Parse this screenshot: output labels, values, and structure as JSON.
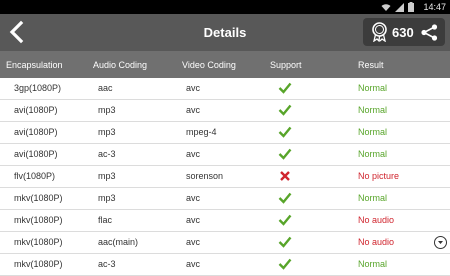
{
  "status": {
    "time": "14:47",
    "icons": [
      "wifi-icon",
      "signal-icon",
      "battery-icon"
    ]
  },
  "header": {
    "title": "Details",
    "score": "630"
  },
  "table": {
    "columns": [
      "Encapsulation",
      "Audio Coding",
      "Video Coding",
      "Support",
      "Result"
    ],
    "rows": [
      {
        "enc": "3gp(1080P)",
        "audio": "aac",
        "video": "avc",
        "support": "check",
        "result": "Normal",
        "status": "normal"
      },
      {
        "enc": "avi(1080P)",
        "audio": "mp3",
        "video": "avc",
        "support": "check",
        "result": "Normal",
        "status": "normal"
      },
      {
        "enc": "avi(1080P)",
        "audio": "mp3",
        "video": "mpeg-4",
        "support": "check",
        "result": "Normal",
        "status": "normal"
      },
      {
        "enc": "avi(1080P)",
        "audio": "ac-3",
        "video": "avc",
        "support": "check",
        "result": "Normal",
        "status": "normal"
      },
      {
        "enc": "flv(1080P)",
        "audio": "mp3",
        "video": "sorenson",
        "support": "cross",
        "result": "No picture",
        "status": "bad"
      },
      {
        "enc": "mkv(1080P)",
        "audio": "mp3",
        "video": "avc",
        "support": "check",
        "result": "Normal",
        "status": "normal"
      },
      {
        "enc": "mkv(1080P)",
        "audio": "flac",
        "video": "avc",
        "support": "check",
        "result": "No audio",
        "status": "bad"
      },
      {
        "enc": "mkv(1080P)",
        "audio": "aac(main)",
        "video": "avc",
        "support": "check",
        "result": "No audio",
        "status": "bad"
      },
      {
        "enc": "mkv(1080P)",
        "audio": "ac-3",
        "video": "avc",
        "support": "check",
        "result": "Normal",
        "status": "normal"
      }
    ]
  },
  "colors": {
    "toolbar": "#585858",
    "header": "#707070",
    "ok": "#58a52a",
    "fail": "#d0252e"
  }
}
